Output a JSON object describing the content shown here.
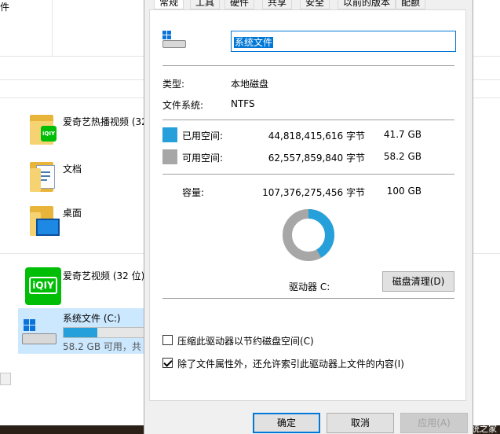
{
  "explorer": {
    "ribbon_fragment": "件",
    "items": [
      {
        "label": "爱奇艺热播视频 (32",
        "type": "folder-app"
      },
      {
        "label": "文档",
        "type": "folder-doc"
      },
      {
        "label": "桌面",
        "type": "folder-desktop"
      },
      {
        "label": "爱奇艺视频 (32 位)",
        "type": "app-iqiyi"
      }
    ],
    "drive": {
      "label": "系统文件 (C:)",
      "free_text": "58.2 GB 可用，共",
      "used_fraction": 0.42
    },
    "bottom_strip_text": "统之家"
  },
  "dialog": {
    "tabs": [
      "常规",
      "工具",
      "硬件",
      "共享",
      "安全",
      "以前的版本",
      "配额"
    ],
    "active_tab": 0,
    "name_value": "系统文件",
    "type_label": "类型:",
    "type_value": "本地磁盘",
    "fs_label": "文件系统:",
    "fs_value": "NTFS",
    "used_label": "已用空间:",
    "used_bytes": "44,818,415,616 字节",
    "used_gb": "41.7 GB",
    "free_label": "可用空间:",
    "free_bytes": "62,557,859,840 字节",
    "free_gb": "58.2 GB",
    "cap_label": "容量:",
    "cap_bytes": "107,376,275,456 字节",
    "cap_gb": "100 GB",
    "used_fraction": 0.417,
    "drive_label": "驱动器 C:",
    "cleanup_button": "磁盘清理(D)",
    "compress_label": "压缩此驱动器以节约磁盘空间(C)",
    "compress_checked": false,
    "index_label": "除了文件属性外，还允许索引此驱动器上文件的内容(I)",
    "index_checked": true,
    "ok_button": "确定",
    "cancel_button": "取消",
    "apply_button": "应用(A)",
    "colors": {
      "used": "#26a0da",
      "free": "#a7a7a7",
      "accent": "#0078d7"
    }
  }
}
